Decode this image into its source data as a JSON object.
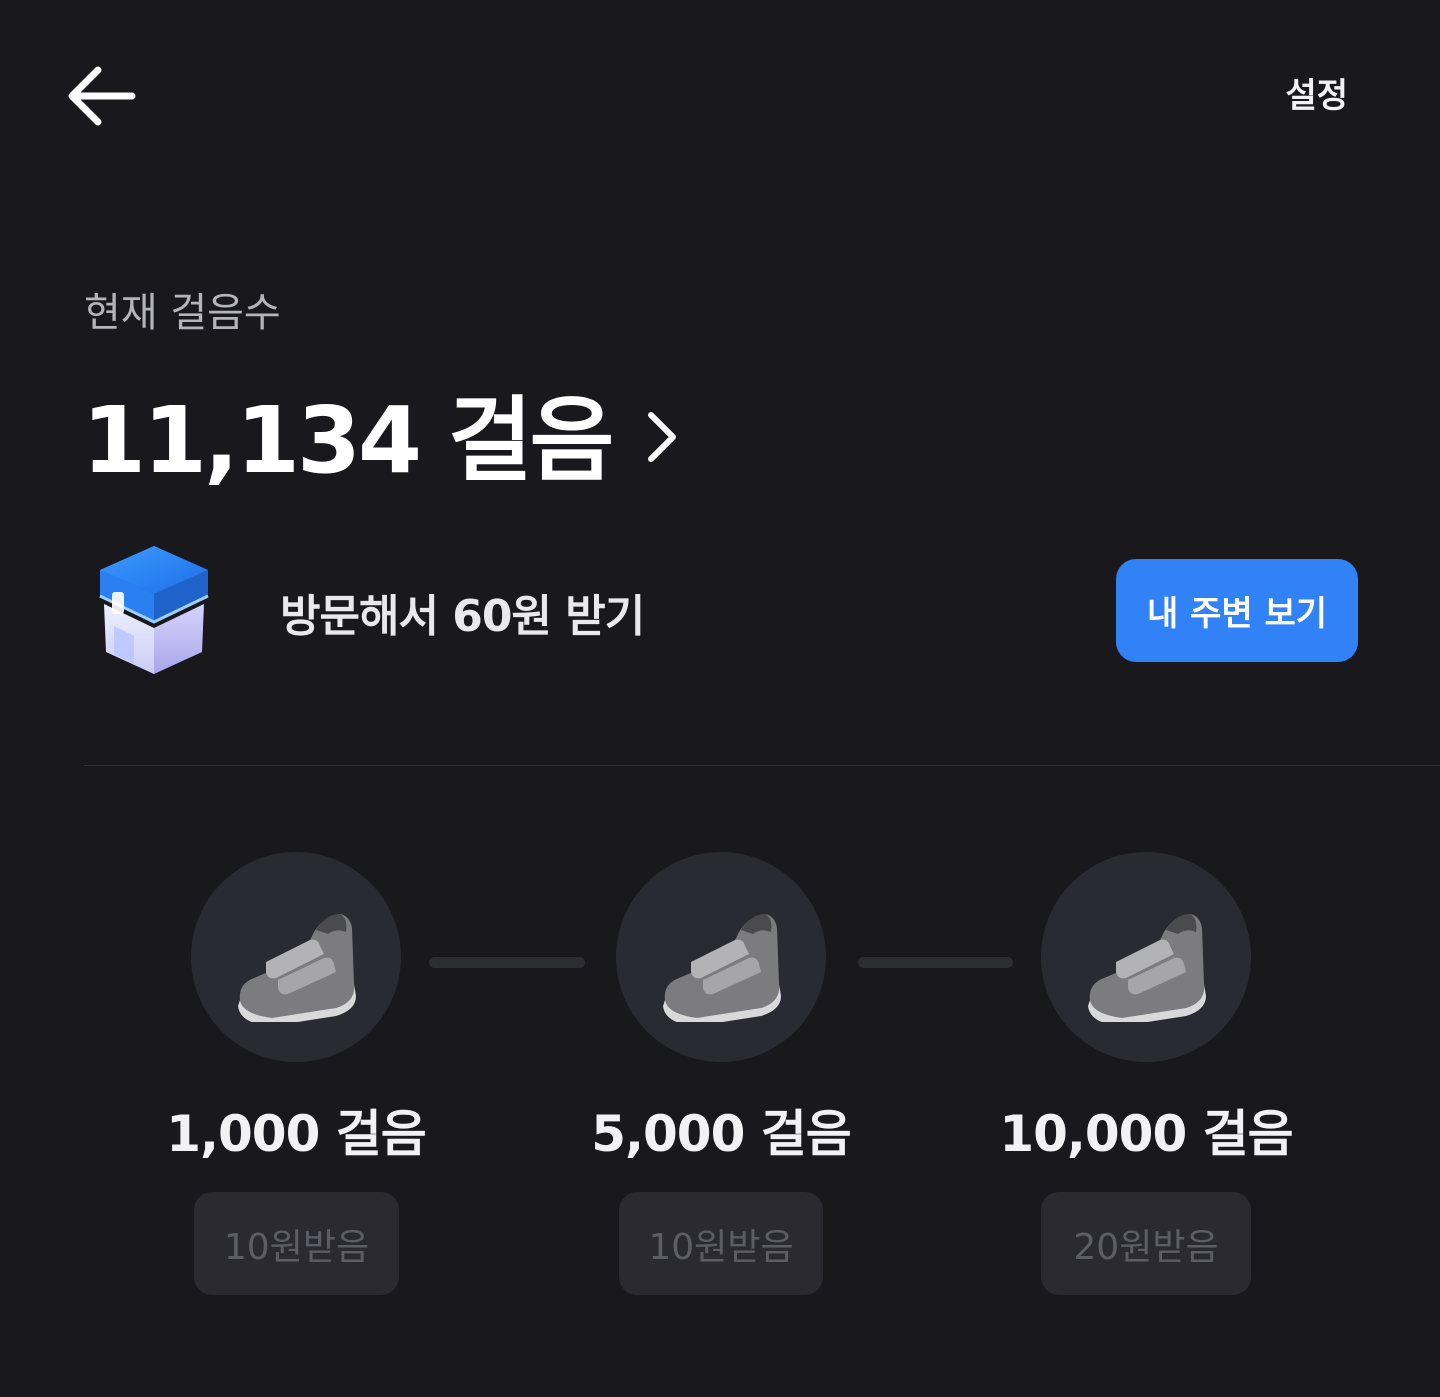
{
  "header": {
    "back_icon": "arrow-left-icon",
    "settings_label": "설정"
  },
  "steps": {
    "label": "현재 걸음수",
    "count_text": "11,134 걸음",
    "chevron_icon": "chevron-right-icon"
  },
  "visit": {
    "icon": "store-box-icon",
    "text": "방문해서 60원 받기",
    "button_label": "내 주변 보기"
  },
  "milestones": [
    {
      "icon": "sneaker-icon",
      "goal": "1,000 걸음",
      "reward_label": "10원받음"
    },
    {
      "icon": "sneaker-icon",
      "goal": "5,000 걸음",
      "reward_label": "10원받음"
    },
    {
      "icon": "sneaker-icon",
      "goal": "10,000 걸음",
      "reward_label": "20원받음"
    }
  ],
  "colors": {
    "background": "#18181d",
    "accent": "#3182f6",
    "circle": "#2a2a32",
    "claimed_button": "#2a2a30",
    "claimed_text": "#5d5d65"
  }
}
